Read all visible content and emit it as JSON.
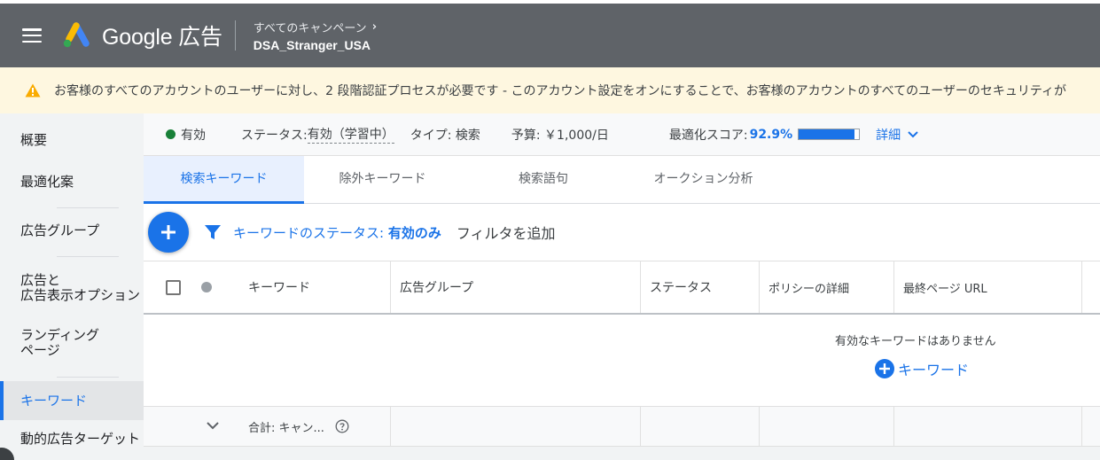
{
  "header": {
    "brand": "Google 広告",
    "breadcrumb_parent": "すべてのキャンペーン",
    "breadcrumb_current": "DSA_Stranger_USA"
  },
  "notice": {
    "text": "お客様のすべてのアカウントのユーザーに対し、2 段階認証プロセスが必要です - このアカウント設定をオンにすることで、お客様のアカウントのすべてのユーザーのセキュリティが"
  },
  "sidebar": {
    "items": [
      {
        "label": "概要"
      },
      {
        "label": "最適化案"
      },
      {
        "label": "広告グループ"
      },
      {
        "label": "広告と\n広告表示オプション"
      },
      {
        "label": "ランディング\nページ"
      },
      {
        "label": "キーワード",
        "active": true
      },
      {
        "label": "動的広告ターゲット"
      }
    ]
  },
  "status_bar": {
    "enabled": "有効",
    "status_label": "ステータス:",
    "status_value": "有効（学習中）",
    "type": "タイプ: 検索",
    "budget": "予算: ￥1,000/日",
    "score_label": "最適化スコア:",
    "score_value": "92.9%",
    "score_fraction": 0.929,
    "details": "詳細"
  },
  "tabs": [
    {
      "label": "検索キーワード",
      "active": true
    },
    {
      "label": "除外キーワード"
    },
    {
      "label": "検索語句"
    },
    {
      "label": "オークション分析"
    }
  ],
  "filter": {
    "label": "キーワードのステータス: ",
    "value": "有効のみ",
    "add_filter": "フィルタを追加"
  },
  "table": {
    "columns": [
      "キーワード",
      "広告グループ",
      "ステータス",
      "ポリシーの詳細",
      "最終ページ URL"
    ],
    "empty_text": "有効なキーワードはありません",
    "add_keyword": "キーワード",
    "total_label": "合計: キャン..."
  },
  "colors": {
    "primary": "#1a73e8",
    "header_bg": "#5f6368",
    "status_green": "#188038",
    "warning": "#f9ab00"
  }
}
